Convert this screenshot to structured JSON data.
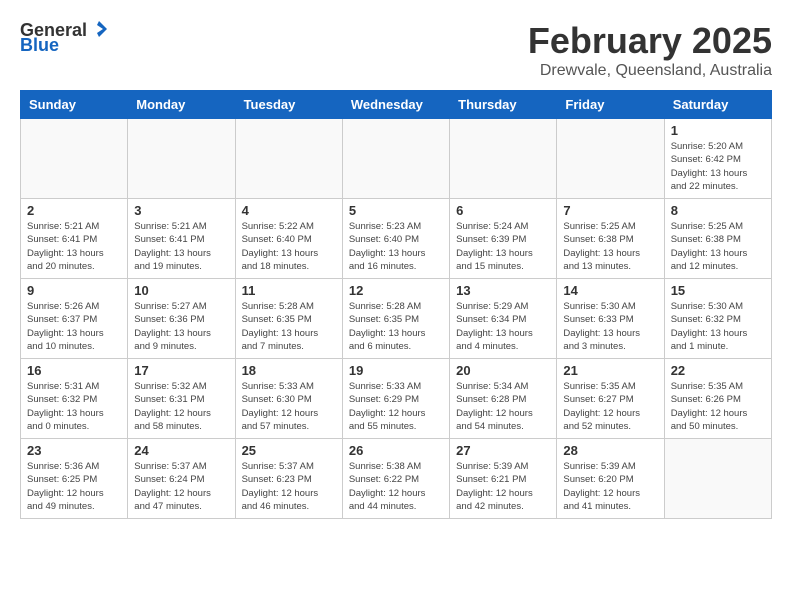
{
  "header": {
    "logo_general": "General",
    "logo_blue": "Blue",
    "title": "February 2025",
    "subtitle": "Drewvale, Queensland, Australia"
  },
  "weekdays": [
    "Sunday",
    "Monday",
    "Tuesday",
    "Wednesday",
    "Thursday",
    "Friday",
    "Saturday"
  ],
  "weeks": [
    [
      {
        "day": "",
        "info": ""
      },
      {
        "day": "",
        "info": ""
      },
      {
        "day": "",
        "info": ""
      },
      {
        "day": "",
        "info": ""
      },
      {
        "day": "",
        "info": ""
      },
      {
        "day": "",
        "info": ""
      },
      {
        "day": "1",
        "info": "Sunrise: 5:20 AM\nSunset: 6:42 PM\nDaylight: 13 hours and 22 minutes."
      }
    ],
    [
      {
        "day": "2",
        "info": "Sunrise: 5:21 AM\nSunset: 6:41 PM\nDaylight: 13 hours and 20 minutes."
      },
      {
        "day": "3",
        "info": "Sunrise: 5:21 AM\nSunset: 6:41 PM\nDaylight: 13 hours and 19 minutes."
      },
      {
        "day": "4",
        "info": "Sunrise: 5:22 AM\nSunset: 6:40 PM\nDaylight: 13 hours and 18 minutes."
      },
      {
        "day": "5",
        "info": "Sunrise: 5:23 AM\nSunset: 6:40 PM\nDaylight: 13 hours and 16 minutes."
      },
      {
        "day": "6",
        "info": "Sunrise: 5:24 AM\nSunset: 6:39 PM\nDaylight: 13 hours and 15 minutes."
      },
      {
        "day": "7",
        "info": "Sunrise: 5:25 AM\nSunset: 6:38 PM\nDaylight: 13 hours and 13 minutes."
      },
      {
        "day": "8",
        "info": "Sunrise: 5:25 AM\nSunset: 6:38 PM\nDaylight: 13 hours and 12 minutes."
      }
    ],
    [
      {
        "day": "9",
        "info": "Sunrise: 5:26 AM\nSunset: 6:37 PM\nDaylight: 13 hours and 10 minutes."
      },
      {
        "day": "10",
        "info": "Sunrise: 5:27 AM\nSunset: 6:36 PM\nDaylight: 13 hours and 9 minutes."
      },
      {
        "day": "11",
        "info": "Sunrise: 5:28 AM\nSunset: 6:35 PM\nDaylight: 13 hours and 7 minutes."
      },
      {
        "day": "12",
        "info": "Sunrise: 5:28 AM\nSunset: 6:35 PM\nDaylight: 13 hours and 6 minutes."
      },
      {
        "day": "13",
        "info": "Sunrise: 5:29 AM\nSunset: 6:34 PM\nDaylight: 13 hours and 4 minutes."
      },
      {
        "day": "14",
        "info": "Sunrise: 5:30 AM\nSunset: 6:33 PM\nDaylight: 13 hours and 3 minutes."
      },
      {
        "day": "15",
        "info": "Sunrise: 5:30 AM\nSunset: 6:32 PM\nDaylight: 13 hours and 1 minute."
      }
    ],
    [
      {
        "day": "16",
        "info": "Sunrise: 5:31 AM\nSunset: 6:32 PM\nDaylight: 13 hours and 0 minutes."
      },
      {
        "day": "17",
        "info": "Sunrise: 5:32 AM\nSunset: 6:31 PM\nDaylight: 12 hours and 58 minutes."
      },
      {
        "day": "18",
        "info": "Sunrise: 5:33 AM\nSunset: 6:30 PM\nDaylight: 12 hours and 57 minutes."
      },
      {
        "day": "19",
        "info": "Sunrise: 5:33 AM\nSunset: 6:29 PM\nDaylight: 12 hours and 55 minutes."
      },
      {
        "day": "20",
        "info": "Sunrise: 5:34 AM\nSunset: 6:28 PM\nDaylight: 12 hours and 54 minutes."
      },
      {
        "day": "21",
        "info": "Sunrise: 5:35 AM\nSunset: 6:27 PM\nDaylight: 12 hours and 52 minutes."
      },
      {
        "day": "22",
        "info": "Sunrise: 5:35 AM\nSunset: 6:26 PM\nDaylight: 12 hours and 50 minutes."
      }
    ],
    [
      {
        "day": "23",
        "info": "Sunrise: 5:36 AM\nSunset: 6:25 PM\nDaylight: 12 hours and 49 minutes."
      },
      {
        "day": "24",
        "info": "Sunrise: 5:37 AM\nSunset: 6:24 PM\nDaylight: 12 hours and 47 minutes."
      },
      {
        "day": "25",
        "info": "Sunrise: 5:37 AM\nSunset: 6:23 PM\nDaylight: 12 hours and 46 minutes."
      },
      {
        "day": "26",
        "info": "Sunrise: 5:38 AM\nSunset: 6:22 PM\nDaylight: 12 hours and 44 minutes."
      },
      {
        "day": "27",
        "info": "Sunrise: 5:39 AM\nSunset: 6:21 PM\nDaylight: 12 hours and 42 minutes."
      },
      {
        "day": "28",
        "info": "Sunrise: 5:39 AM\nSunset: 6:20 PM\nDaylight: 12 hours and 41 minutes."
      },
      {
        "day": "",
        "info": ""
      }
    ]
  ]
}
